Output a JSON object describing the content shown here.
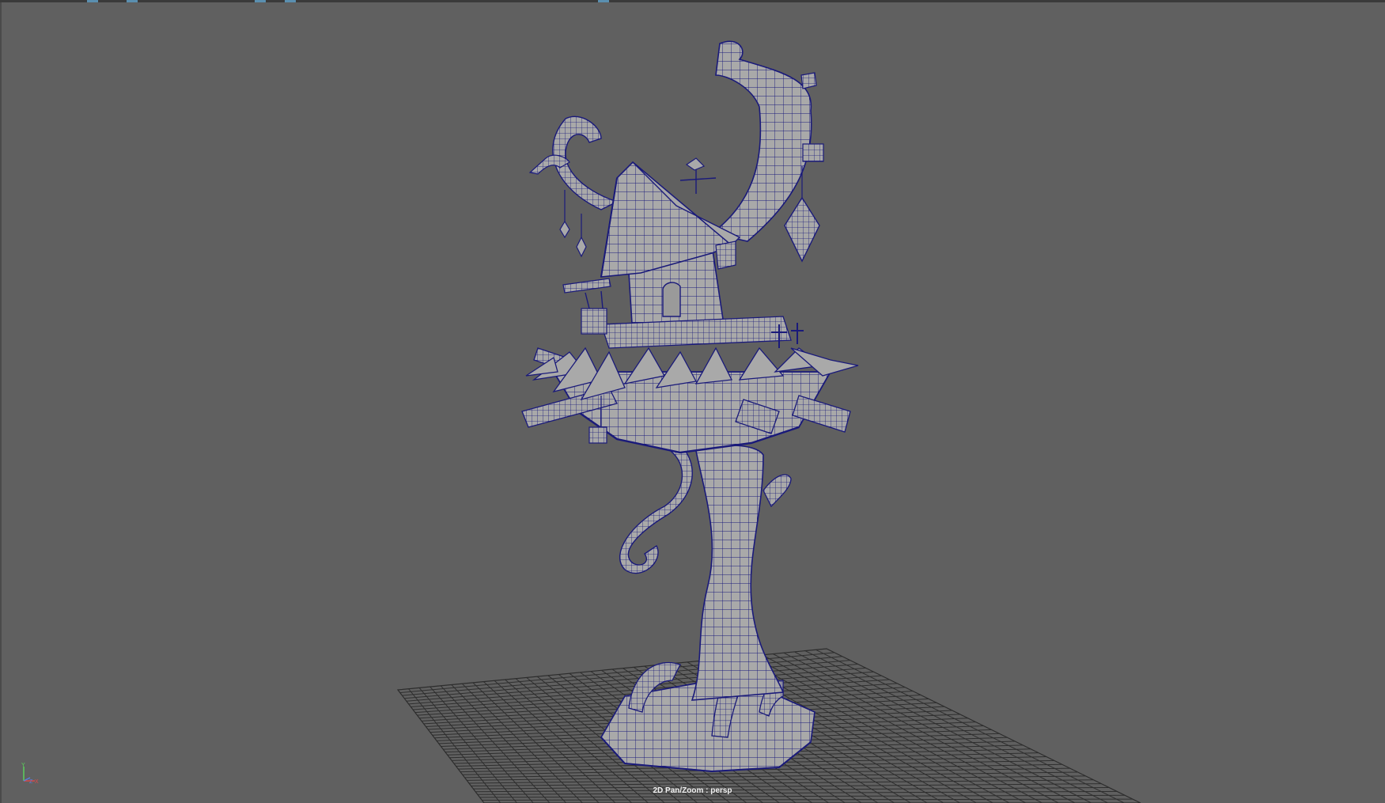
{
  "viewport": {
    "camera_label": "2D Pan/Zoom : persp",
    "background_color": "#606060",
    "wire_color": "#1a1a7a",
    "mesh_fill": "#a9a9a9",
    "grid_color": "#2e2e2e"
  },
  "axis_gizmo": {
    "y_label": "Y",
    "x_label": "X",
    "z_label": "Z",
    "y_color": "#5ad75a",
    "x_color": "#e04848",
    "z_color": "#5a7de0"
  },
  "icons": {
    "toolbar_strip": "toolbar-icons",
    "axis": "axis-gizmo-icon"
  }
}
